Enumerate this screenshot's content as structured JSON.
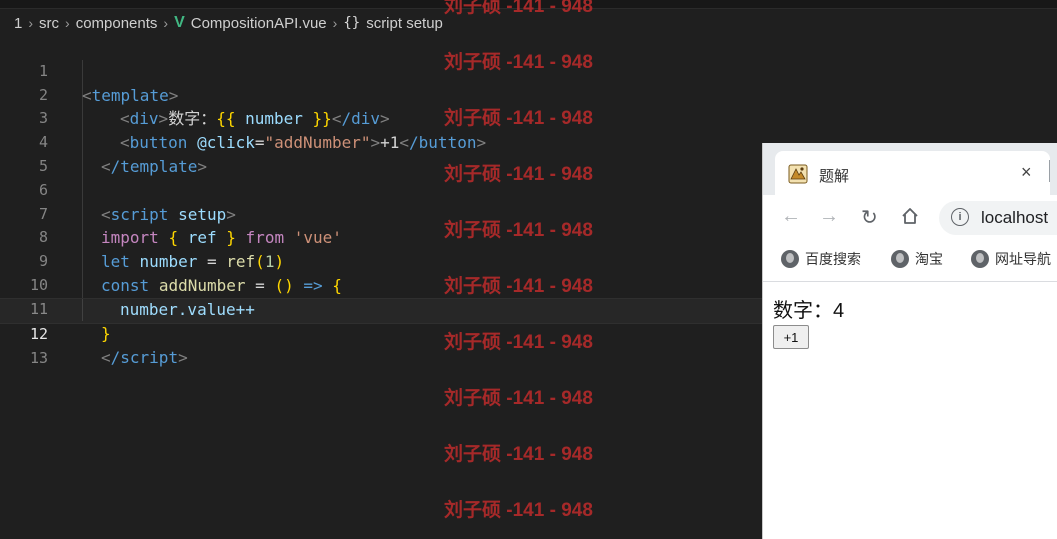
{
  "breadcrumb": {
    "items": [
      "1",
      "src",
      "components",
      "CompositionAPI.vue",
      "script setup"
    ],
    "vue_icon": "V",
    "braces_icon": "{}"
  },
  "code": {
    "active_line": 12,
    "lines": [
      {
        "n": "1"
      },
      {
        "n": "2"
      },
      {
        "n": "3"
      },
      {
        "n": "4"
      },
      {
        "n": "5"
      },
      {
        "n": "6"
      },
      {
        "n": "7"
      },
      {
        "n": "8"
      },
      {
        "n": "9"
      },
      {
        "n": "10"
      },
      {
        "n": "11"
      },
      {
        "n": "12"
      },
      {
        "n": "13"
      }
    ],
    "tokens": {
      "l1_tag": "template",
      "l2_tag1": "div",
      "l2_text": "数字：",
      "l2_open": "{{",
      "l2_var": "number",
      "l2_close": "}}",
      "l2_tag2": "/div",
      "l3_tag": "button",
      "l3_attr": "@click",
      "l3_val": "\"addNumber\"",
      "l3_text": "+1",
      "l3_tag2": "/button",
      "l4_tag": "/template",
      "l6_tag": "script",
      "l6_attr": "setup",
      "l7_import": "import",
      "l7_ob": "{",
      "l7_ref": "ref",
      "l7_cb": "}",
      "l7_from": "from",
      "l7_str": "'vue'",
      "l8_let": "let",
      "l8_var": "number",
      "l8_eq": "=",
      "l8_fn": "ref",
      "l8_num": "1",
      "l9_const": "const",
      "l9_fn": "addNumber",
      "l9_eq": "=",
      "l9_parens": "()",
      "l9_arrow": "=>",
      "l9_ob": "{",
      "l10_var": "number",
      "l10_rest": ".value++",
      "l11_cb": "}",
      "l12_tag": "/script"
    }
  },
  "watermark": {
    "text": "刘子硕 -141 - 948"
  },
  "browser": {
    "tab_title": "题解",
    "tab_close": "×",
    "url": "localhost",
    "bookmarks": [
      "百度搜索",
      "淘宝",
      "网址导航"
    ],
    "content": {
      "number_label": "数字：",
      "number_value": "4",
      "button_label": "+1"
    }
  }
}
